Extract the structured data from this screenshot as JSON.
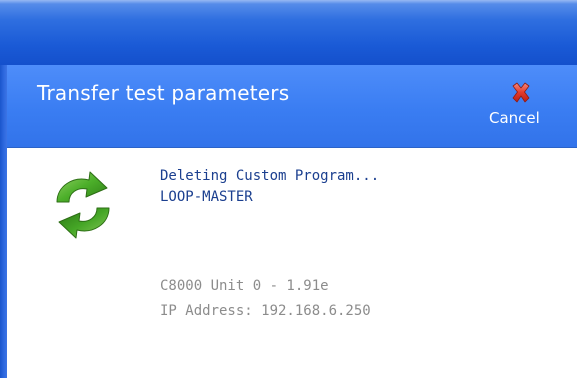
{
  "dialog": {
    "header_title": "Transfer test parameters",
    "cancel_label": "Cancel",
    "cancel_icon": "red-x-icon",
    "status_icon": "green-sync-arrows-icon"
  },
  "status": {
    "action": "Deleting Custom Program...",
    "program_name": "LOOP-MASTER"
  },
  "device": {
    "unit": "C8000 Unit 0 - 1.91e",
    "ip_address": "IP Address: 192.168.6.250"
  },
  "colors": {
    "titlebar": "#1a5ad6",
    "header": "#3a7df2",
    "status_text": "#1b3f8f",
    "info_text": "#8c8c8c",
    "icon_green": "#4caf2a",
    "cancel_red": "#d62b2b"
  }
}
